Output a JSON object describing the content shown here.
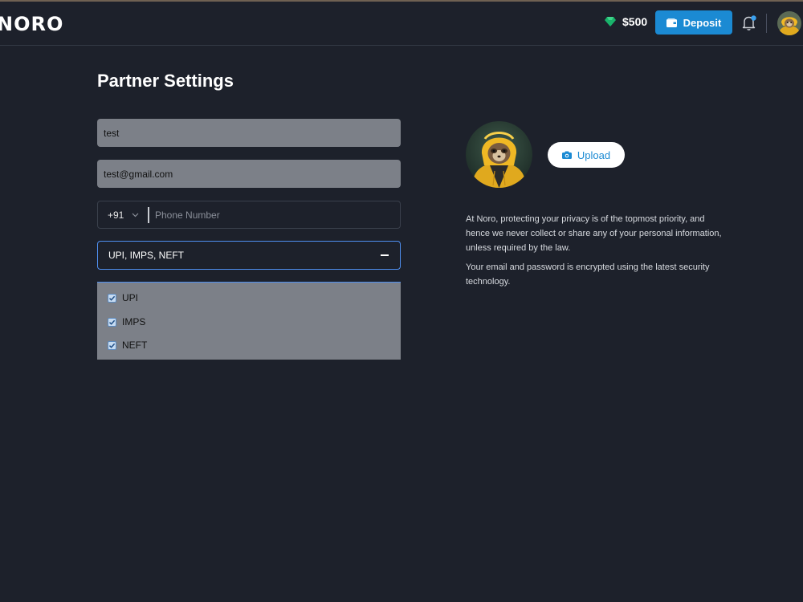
{
  "header": {
    "logo": "NORO",
    "balance": "$500",
    "deposit_label": "Deposit",
    "icons": {
      "balance": "gem-icon",
      "deposit": "wallet-icon",
      "notifications": "bell-icon",
      "profile": "avatar"
    },
    "colors": {
      "accent": "#1b8ad3",
      "gem": "#19b36b",
      "notification_dot": "#3aa0ee"
    }
  },
  "page": {
    "title": "Partner Settings"
  },
  "form": {
    "name_value": "test",
    "email_value": "test@gmail.com",
    "phone": {
      "country_code": "+91",
      "placeholder": "Phone Number"
    },
    "payment_methods": {
      "selected_text": "UPI, IMPS, NEFT",
      "options": [
        {
          "label": "UPI",
          "checked": true
        },
        {
          "label": "IMPS",
          "checked": true
        },
        {
          "label": "NEFT",
          "checked": true
        }
      ]
    }
  },
  "profile": {
    "upload_label": "Upload",
    "privacy_paragraphs": [
      "At Noro, protecting your privacy is of the topmost priority, and hence we never collect or share any of your personal information, unless required by the law.",
      "Your email and password is encrypted using the latest security technology."
    ]
  }
}
